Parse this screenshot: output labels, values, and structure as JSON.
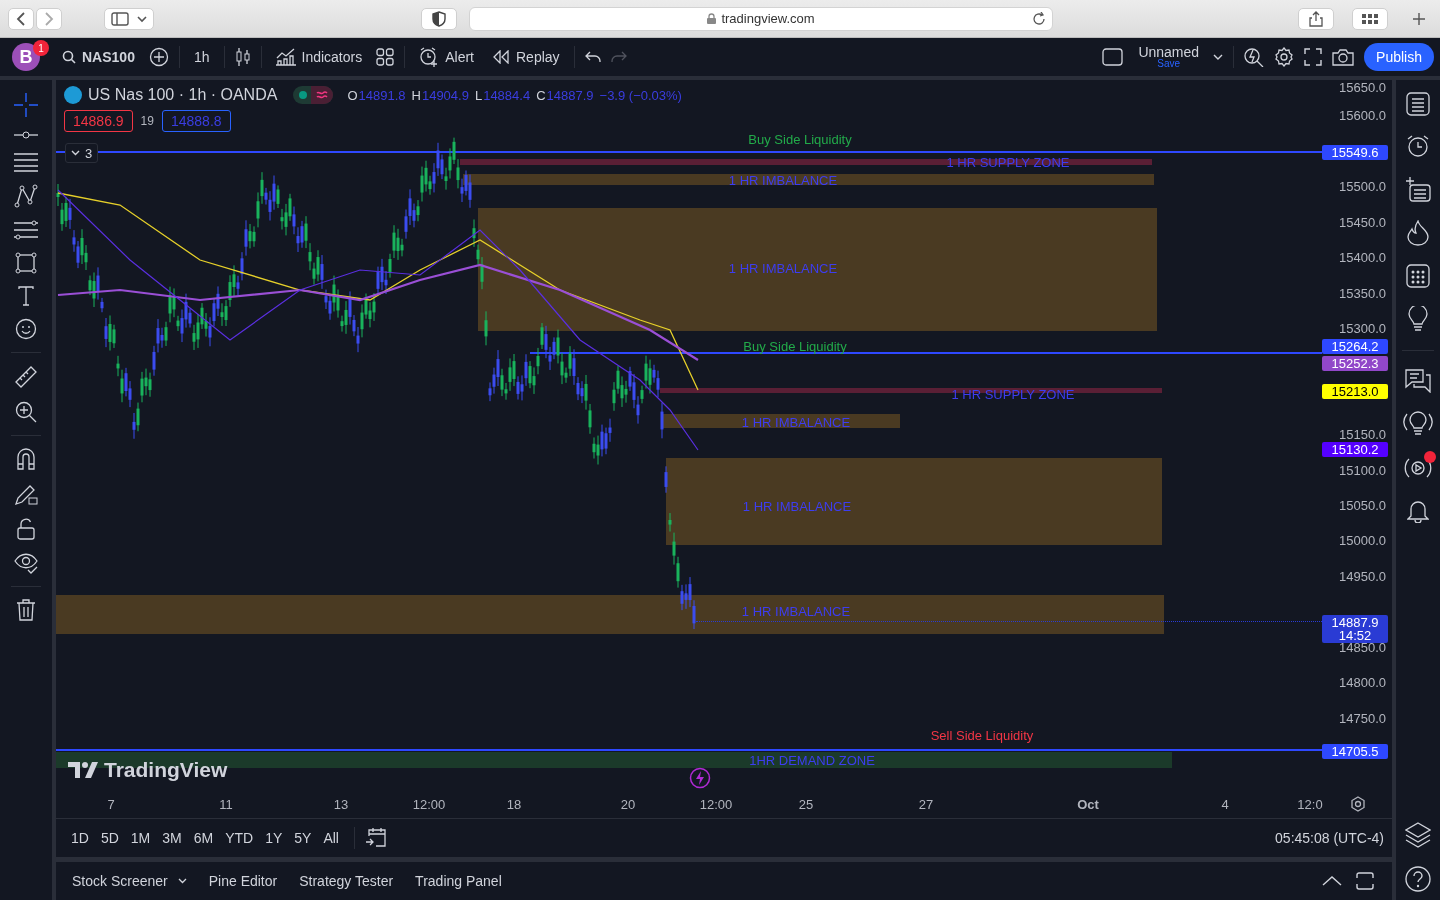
{
  "browser": {
    "url": "tradingview.com"
  },
  "toolbar": {
    "avatar": "B",
    "notifications": "1",
    "symbol": "NAS100",
    "interval": "1h",
    "indicators": "Indicators",
    "alert": "Alert",
    "replay": "Replay",
    "layout_name": "Unnamed",
    "save": "Save",
    "publish": "Publish"
  },
  "legend": {
    "title": "US Nas 100 · 1h · OANDA",
    "ohlc": [
      {
        "key": "O",
        "value": "14891.8"
      },
      {
        "key": "H",
        "value": "14904.9"
      },
      {
        "key": "L",
        "value": "14884.4"
      },
      {
        "key": "C",
        "value": "14887.9"
      }
    ],
    "change": "−3.9 (−0.03%)",
    "bid": "14886.9",
    "spread": "19",
    "ask": "14888.8",
    "collapsed_count": "3"
  },
  "drawings": [
    {
      "kind": "liquidity",
      "label": "Buy Side Liquidity",
      "color": "#22ab4a"
    },
    {
      "kind": "supply",
      "label": "1 HR SUPPLY ZONE"
    },
    {
      "kind": "imbalance",
      "label": "1 HR IMBALANCE"
    },
    {
      "kind": "imbalance",
      "label": "1 HR IMBALANCE"
    },
    {
      "kind": "liquidity",
      "label": "Buy Side Liquidity",
      "color": "#22ab4a"
    },
    {
      "kind": "supply",
      "label": "1 HR SUPPLY ZONE"
    },
    {
      "kind": "imbalance",
      "label": "1 HR IMBALANCE"
    },
    {
      "kind": "imbalance",
      "label": "1 HR IMBALANCE"
    },
    {
      "kind": "imbalance",
      "label": "1 HR IMBALANCE"
    },
    {
      "kind": "liquidity",
      "label": "Sell Side Liquidity",
      "color": "#f23645"
    },
    {
      "kind": "demand",
      "label": "1HR DEMAND ZONE"
    }
  ],
  "watermark": "TradingView",
  "price_axis": [
    "15650.0",
    "15600.0",
    "15500.0",
    "15450.0",
    "15400.0",
    "15350.0",
    "15300.0",
    "15150.0",
    "15100.0",
    "15050.0",
    "15000.0",
    "14950.0",
    "14850.0",
    "14800.0",
    "14750.0"
  ],
  "price_tags": [
    {
      "value": "15549.6",
      "color": "#2e48ff"
    },
    {
      "value": "15264.2",
      "color": "#2e48ff"
    },
    {
      "value": "15252.3",
      "color": "#9147c9"
    },
    {
      "value": "15213.0",
      "color": "#ffff00"
    },
    {
      "value": "15130.2",
      "color": "#5500ff"
    },
    {
      "value": "14887.9",
      "time": "14:52",
      "color": "#2a3bd4"
    },
    {
      "value": "14705.5",
      "color": "#2e48ff"
    }
  ],
  "time_axis": [
    {
      "label": "7",
      "kind": "day"
    },
    {
      "label": "11",
      "kind": "day"
    },
    {
      "label": "13",
      "kind": "day"
    },
    {
      "label": "12:00",
      "kind": "time"
    },
    {
      "label": "18",
      "kind": "day"
    },
    {
      "label": "20",
      "kind": "day"
    },
    {
      "label": "12:00",
      "kind": "time"
    },
    {
      "label": "25",
      "kind": "day"
    },
    {
      "label": "27",
      "kind": "day"
    },
    {
      "label": "Oct",
      "kind": "month"
    },
    {
      "label": "4",
      "kind": "day"
    },
    {
      "label": "12:0",
      "kind": "time"
    }
  ],
  "ranges": [
    "1D",
    "5D",
    "1M",
    "3M",
    "6M",
    "YTD",
    "1Y",
    "5Y",
    "All"
  ],
  "clock": "05:45:08 (UTC-4)",
  "bottom_tabs": [
    {
      "label": "Stock Screener",
      "dropdown": true
    },
    {
      "label": "Pine Editor",
      "dropdown": false
    },
    {
      "label": "Strategy Tester",
      "dropdown": false
    },
    {
      "label": "Trading Panel",
      "dropdown": false
    }
  ]
}
